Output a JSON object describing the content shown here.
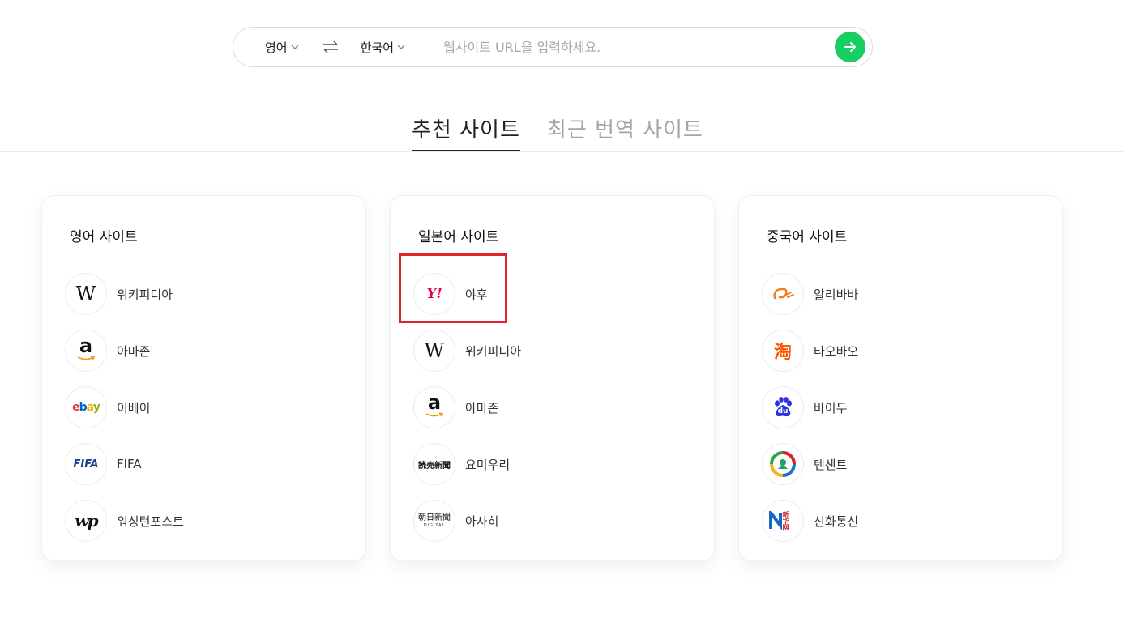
{
  "search": {
    "source_lang": "영어",
    "target_lang": "한국어",
    "url_placeholder": "웹사이트 URL을 입력하세요.",
    "url_value": ""
  },
  "tabs": [
    {
      "label": "추천 사이트",
      "active": true
    },
    {
      "label": "최근 번역 사이트",
      "active": false
    }
  ],
  "cards": [
    {
      "title": "영어 사이트",
      "sites": [
        {
          "name": "위키피디아",
          "icon": "wikipedia-logo"
        },
        {
          "name": "아마존",
          "icon": "amazon-logo"
        },
        {
          "name": "이베이",
          "icon": "ebay-logo"
        },
        {
          "name": "FIFA",
          "icon": "fifa-logo"
        },
        {
          "name": "워싱턴포스트",
          "icon": "washington-post-logo"
        }
      ]
    },
    {
      "title": "일본어 사이트",
      "sites": [
        {
          "name": "야후",
          "icon": "yahoo-logo"
        },
        {
          "name": "위키피디아",
          "icon": "wikipedia-logo"
        },
        {
          "name": "아마존",
          "icon": "amazon-logo"
        },
        {
          "name": "요미우리",
          "icon": "yomiuri-logo"
        },
        {
          "name": "아사히",
          "icon": "asahi-logo"
        }
      ]
    },
    {
      "title": "중국어 사이트",
      "sites": [
        {
          "name": "알리바바",
          "icon": "alibaba-logo"
        },
        {
          "name": "타오바오",
          "icon": "taobao-logo"
        },
        {
          "name": "바이두",
          "icon": "baidu-logo"
        },
        {
          "name": "텐센트",
          "icon": "tencent-logo"
        },
        {
          "name": "신화통신",
          "icon": "xinhua-logo"
        }
      ]
    }
  ],
  "logos": {
    "wikipedia": "W",
    "amazon": "a",
    "ebay": [
      "e",
      "b",
      "a",
      "y"
    ],
    "fifa": "FIFA",
    "washington_post": "wp",
    "yahoo": "Y!",
    "yomiuri": "読売新聞",
    "asahi": "朝日新聞",
    "asahi_sub": "DIGITAL",
    "taobao": "淘",
    "baidu": "du",
    "xinhua": "新华网"
  },
  "colors": {
    "go_button": "#19ce60",
    "highlight": "#e0232f",
    "tab_active": "#222222",
    "tab_inactive": "#a5a5a5"
  }
}
